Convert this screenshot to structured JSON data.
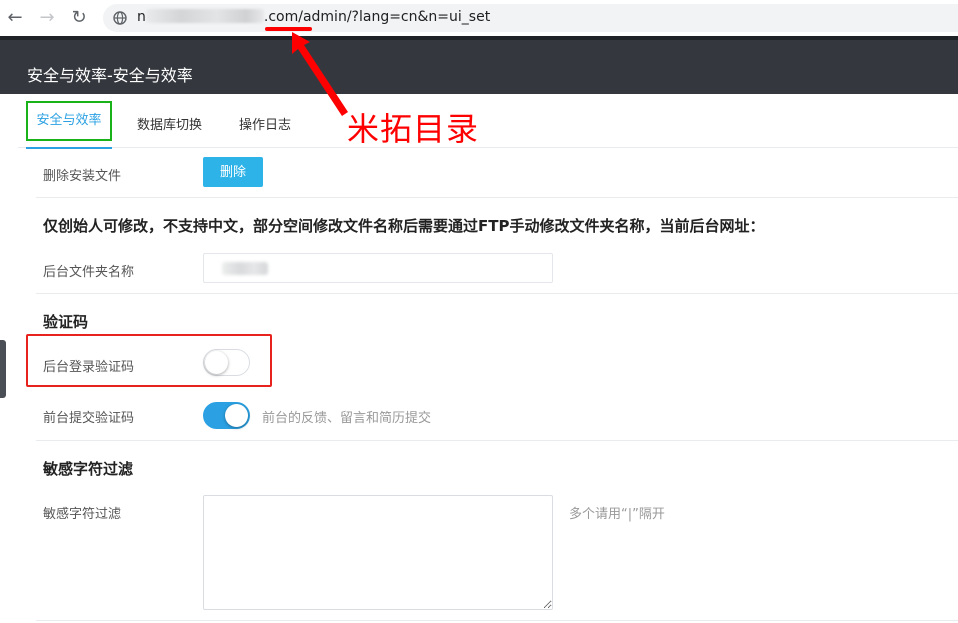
{
  "browser": {
    "url_prefix": "n",
    "url_suffix": ".com/",
    "url_admin": "admin",
    "url_query": "/?lang=cn&n=ui_set"
  },
  "header": {
    "title": "安全与效率-安全与效率"
  },
  "tabs": [
    {
      "label": "安全与效率",
      "active": true
    },
    {
      "label": "数据库切换",
      "active": false
    },
    {
      "label": "操作日志",
      "active": false
    }
  ],
  "annotation": {
    "text": "米拓目录",
    "color": "#ff0000"
  },
  "install_files": {
    "label": "删除安装文件",
    "button": "删除"
  },
  "notice": "仅创始人可修改，不支持中文，部分空间修改文件名称后需要通过FTP手动修改文件夹名称，当前后台网址：",
  "admin_folder": {
    "label": "后台文件夹名称"
  },
  "captcha": {
    "section_title": "验证码",
    "backend_label": "后台登录验证码",
    "backend_enabled": false,
    "frontend_label": "前台提交验证码",
    "frontend_enabled": true,
    "frontend_hint": "前台的反馈、留言和简历提交"
  },
  "filter": {
    "section_title": "敏感字符过滤",
    "label": "敏感字符过滤",
    "hint": "多个请用“|”隔开",
    "value": ""
  },
  "colors": {
    "accent": "#2ba1e3",
    "header_bg": "#34383e",
    "highlight_green": "#19b219",
    "highlight_red": "#e8231e"
  }
}
